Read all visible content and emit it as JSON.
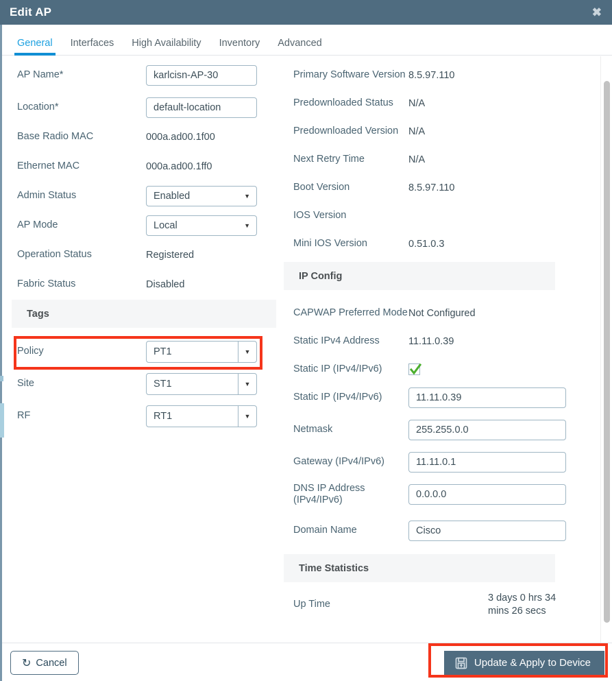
{
  "titlebar": {
    "title": "Edit AP",
    "close_icon": "close-icon"
  },
  "tabs": [
    {
      "label": "General",
      "active": true
    },
    {
      "label": "Interfaces",
      "active": false
    },
    {
      "label": "High Availability",
      "active": false
    },
    {
      "label": "Inventory",
      "active": false
    },
    {
      "label": "Advanced",
      "active": false
    }
  ],
  "left": {
    "ap_name": {
      "label": "AP Name*",
      "value": "karlcisn-AP-30"
    },
    "location": {
      "label": "Location*",
      "value": "default-location"
    },
    "base_radio_mac": {
      "label": "Base Radio MAC",
      "value": "000a.ad00.1f00"
    },
    "ethernet_mac": {
      "label": "Ethernet MAC",
      "value": "000a.ad00.1ff0"
    },
    "admin_status": {
      "label": "Admin Status",
      "value": "Enabled"
    },
    "ap_mode": {
      "label": "AP Mode",
      "value": "Local"
    },
    "operation_status": {
      "label": "Operation Status",
      "value": "Registered"
    },
    "fabric_status": {
      "label": "Fabric Status",
      "value": "Disabled"
    },
    "tags_section": "Tags",
    "policy": {
      "label": "Policy",
      "value": "PT1"
    },
    "site": {
      "label": "Site",
      "value": "ST1"
    },
    "rf": {
      "label": "RF",
      "value": "RT1"
    }
  },
  "right": {
    "primary_software_version": {
      "label": "Primary Software Version",
      "value": "8.5.97.110"
    },
    "predownloaded_status": {
      "label": "Predownloaded Status",
      "value": "N/A"
    },
    "predownloaded_version": {
      "label": "Predownloaded Version",
      "value": "N/A"
    },
    "next_retry_time": {
      "label": "Next Retry Time",
      "value": "N/A"
    },
    "boot_version": {
      "label": "Boot Version",
      "value": "8.5.97.110"
    },
    "ios_version": {
      "label": "IOS Version",
      "value": ""
    },
    "mini_ios_version": {
      "label": "Mini IOS Version",
      "value": "0.51.0.3"
    },
    "ip_config_section": "IP Config",
    "capwap_preferred_mode": {
      "label": "CAPWAP Preferred Mode",
      "value": "Not Configured"
    },
    "static_ipv4_address": {
      "label": "Static IPv4 Address",
      "value": "11.11.0.39"
    },
    "static_ip_checkbox": {
      "label": "Static IP (IPv4/IPv6)",
      "checked": true
    },
    "static_ip_field": {
      "label": "Static IP (IPv4/IPv6)",
      "value": "11.11.0.39"
    },
    "netmask": {
      "label": "Netmask",
      "value": "255.255.0.0"
    },
    "gateway": {
      "label": "Gateway (IPv4/IPv6)",
      "value": "11.11.0.1"
    },
    "dns_ip_address": {
      "label": "DNS IP Address\n(IPv4/IPv6)",
      "value": "0.0.0.0"
    },
    "domain_name": {
      "label": "Domain Name",
      "value": "Cisco"
    },
    "time_statistics_section": "Time Statistics",
    "up_time": {
      "label": "Up Time",
      "value": "3 days 0 hrs 34\nmins 26 secs"
    }
  },
  "footer": {
    "cancel_label": "Cancel",
    "cancel_icon": "undo-icon",
    "update_label": "Update & Apply to Device",
    "update_icon": "save-icon"
  },
  "colors": {
    "titlebar": "#4f6c80",
    "active_tab": "#1ca0e0",
    "highlight": "#f5351b",
    "primary_button": "#4f6c80",
    "check_green": "#4caf2e"
  }
}
